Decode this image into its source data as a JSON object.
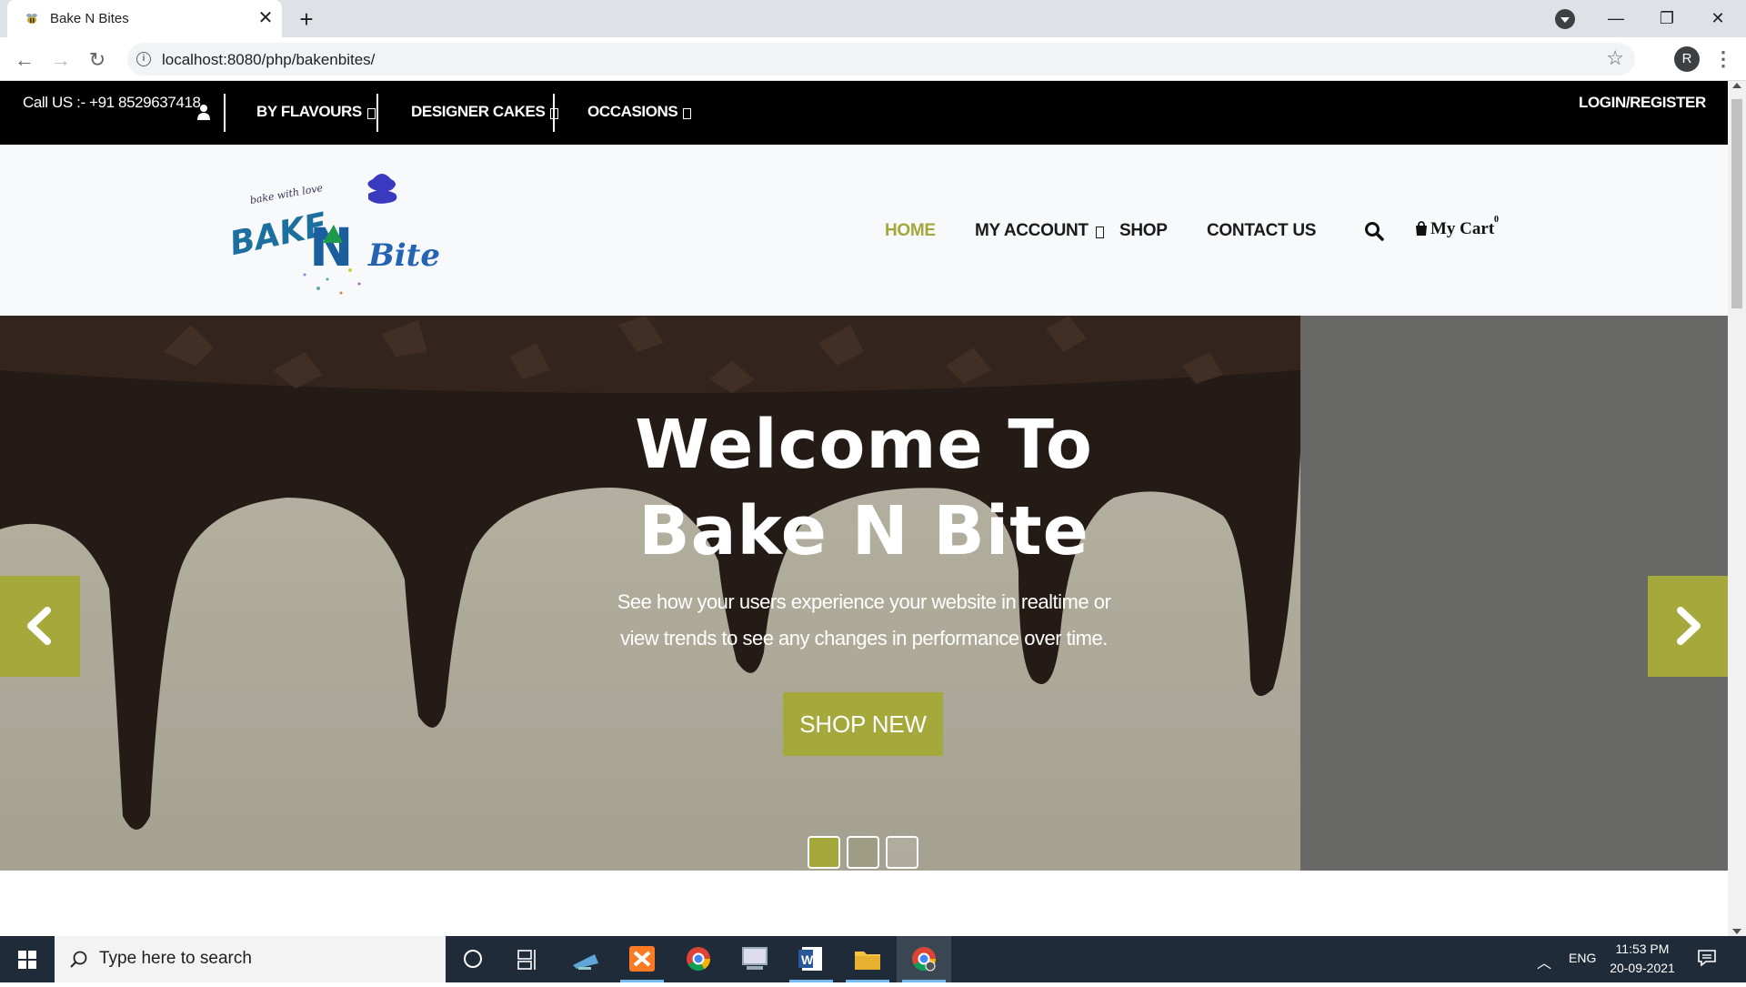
{
  "browser": {
    "tab_title": "Bake N Bites",
    "url": "localhost:8080/php/bakenbites/",
    "profile_initial": "R"
  },
  "topbar": {
    "call_us": "Call US :- +91 8529637418",
    "menu": [
      "BY FLAVOURS",
      "DESIGNER CAKES",
      "OCCASIONS"
    ],
    "login": "LOGIN/REGISTER"
  },
  "nav": {
    "home": "HOME",
    "my_account": "MY ACCOUNT",
    "shop": "SHOP",
    "contact": "CONTACT US",
    "cart_label": "My Cart",
    "cart_count": "0"
  },
  "logo": {
    "tagline": "bake with love",
    "word1": "BAKE",
    "word2": "N",
    "word3": "Bite"
  },
  "hero": {
    "title_line1": "Welcome To",
    "title_line2": "Bake N Bite",
    "subtitle": "See how your users experience your website in realtime or view trends to see any changes in performance over time.",
    "button": "SHOP NEW",
    "slide_count": 3,
    "active_slide": 1
  },
  "taskbar": {
    "search_placeholder": "Type here to search",
    "lang": "ENG",
    "time": "11:53 PM",
    "date": "20-09-2021"
  },
  "colors": {
    "accent": "#a5a83a",
    "topbar_bg": "#000000",
    "header_bg": "#f8f9fa"
  }
}
